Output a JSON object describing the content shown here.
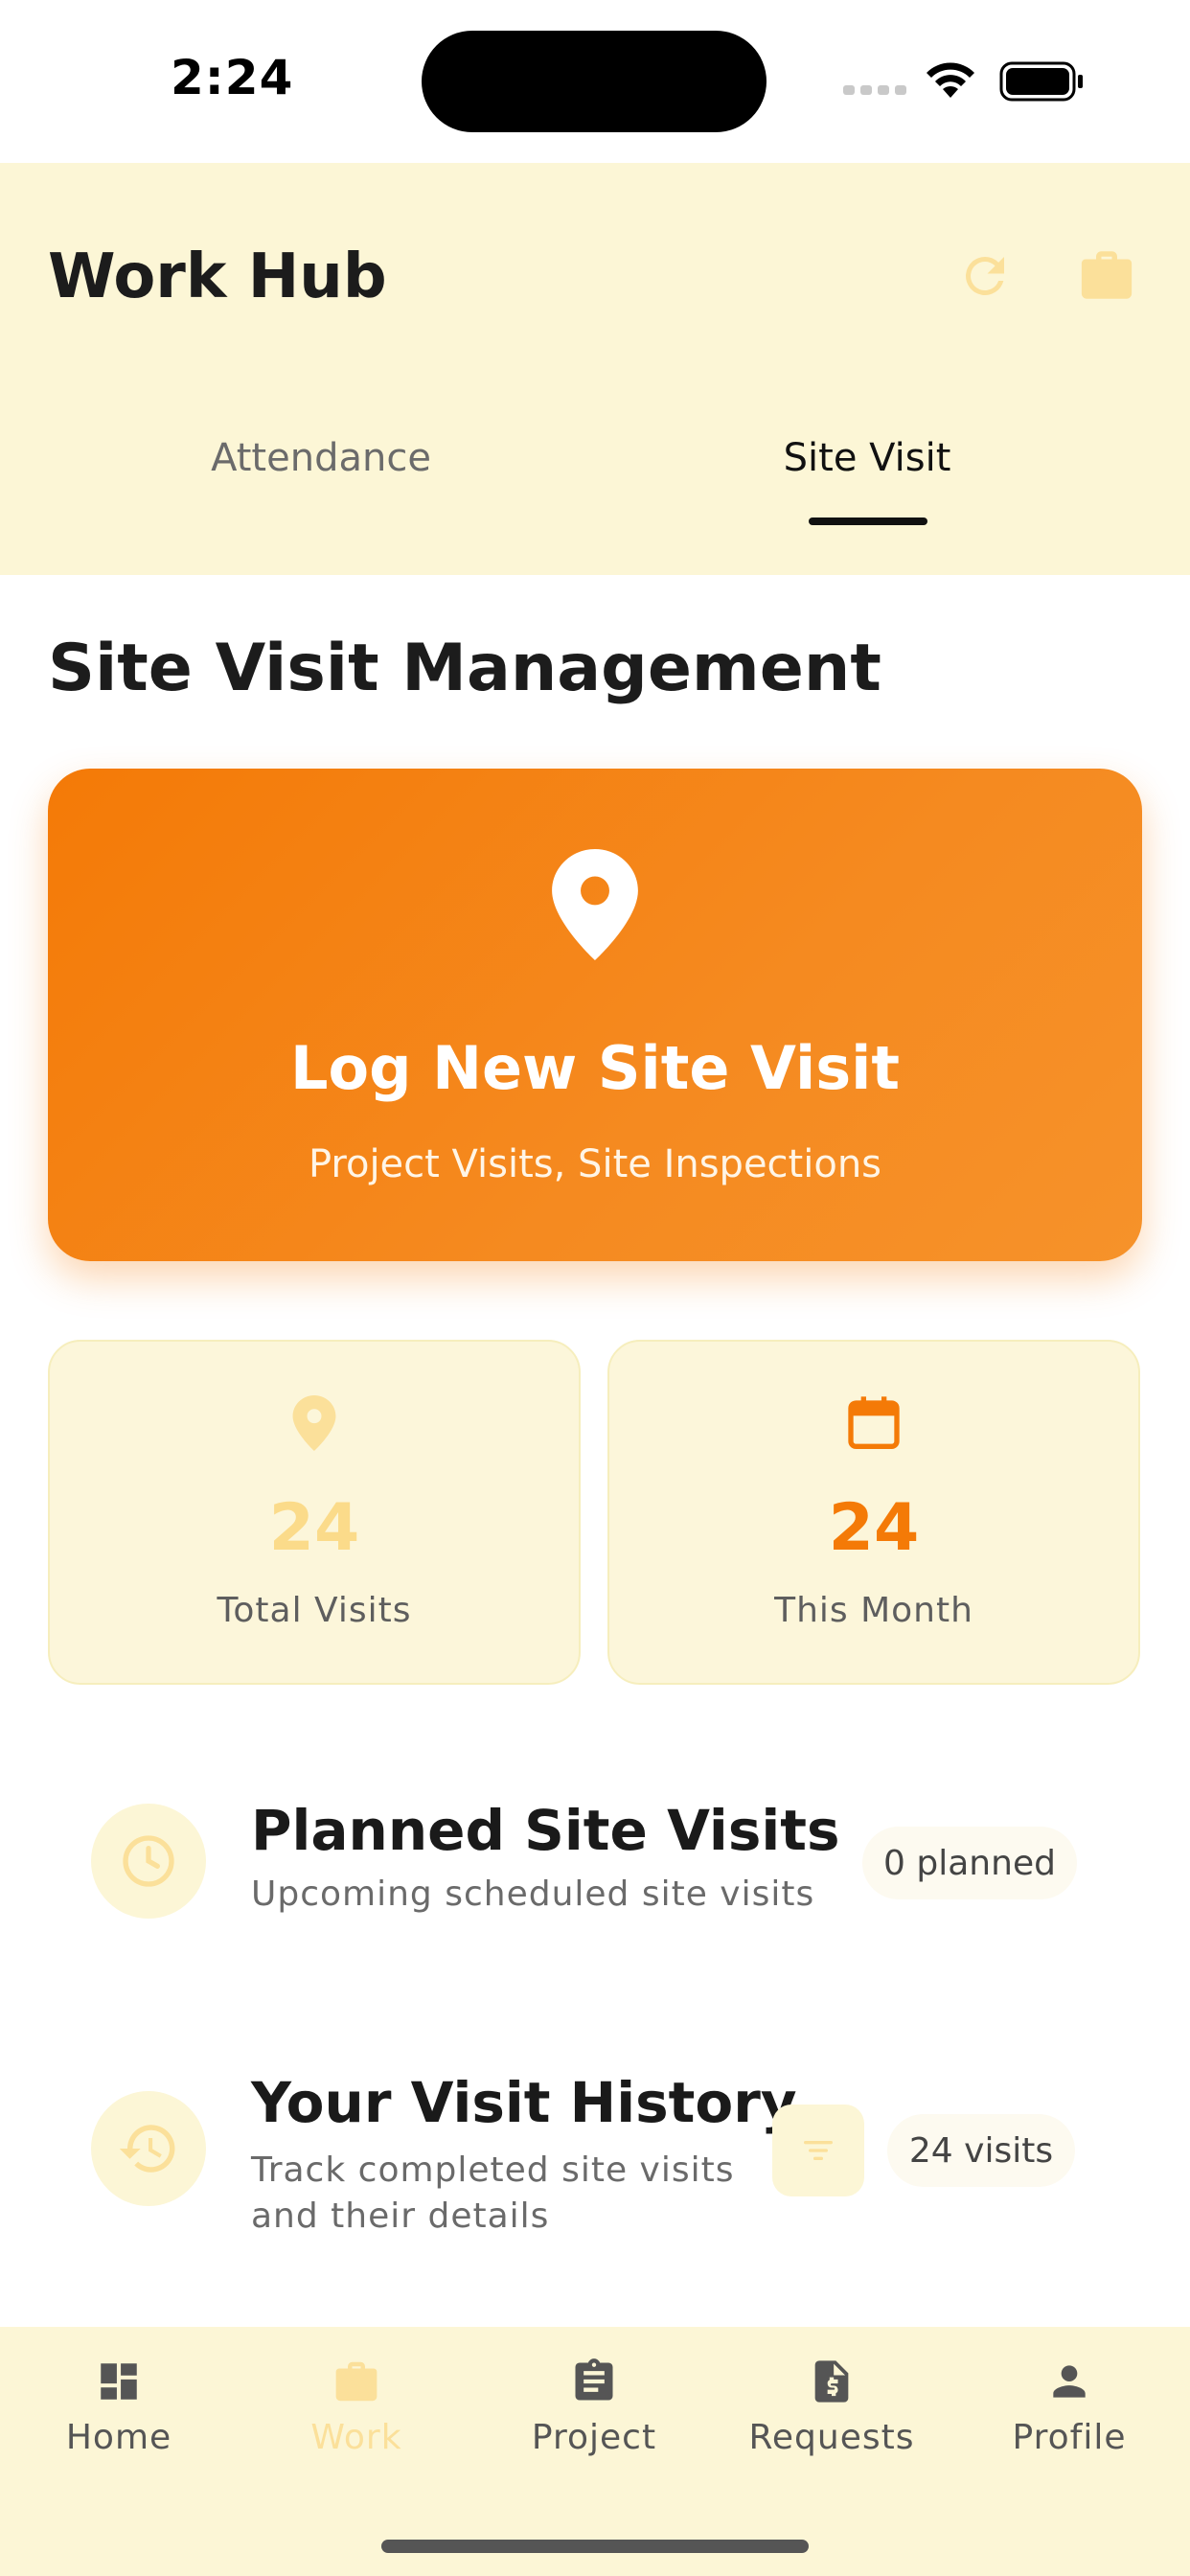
{
  "status_bar": {
    "time": "2:24"
  },
  "header": {
    "title": "Work Hub",
    "tabs": [
      {
        "label": "Attendance"
      },
      {
        "label": "Site Visit"
      }
    ]
  },
  "section": {
    "title": "Site Visit Management"
  },
  "cta": {
    "title": "Log New Site Visit",
    "subtitle": "Project Visits, Site Inspections"
  },
  "stats": [
    {
      "value": "24",
      "label": "Total Visits"
    },
    {
      "value": "24",
      "label": "This Month"
    }
  ],
  "planned": {
    "title": "Planned Site Visits",
    "subtitle": "Upcoming scheduled site visits",
    "badge": "0 planned"
  },
  "history": {
    "title": "Your Visit History",
    "subtitle_line1": "Track completed site visits",
    "subtitle_line2": "and their details",
    "badge": "24 visits"
  },
  "bottom_nav": {
    "items": [
      {
        "label": "Home"
      },
      {
        "label": "Work"
      },
      {
        "label": "Project"
      },
      {
        "label": "Requests"
      },
      {
        "label": "Profile"
      }
    ]
  },
  "colors": {
    "accent": "#f47a07",
    "header_bg": "#fcf6d6",
    "icon_pale": "#fbe09a"
  }
}
